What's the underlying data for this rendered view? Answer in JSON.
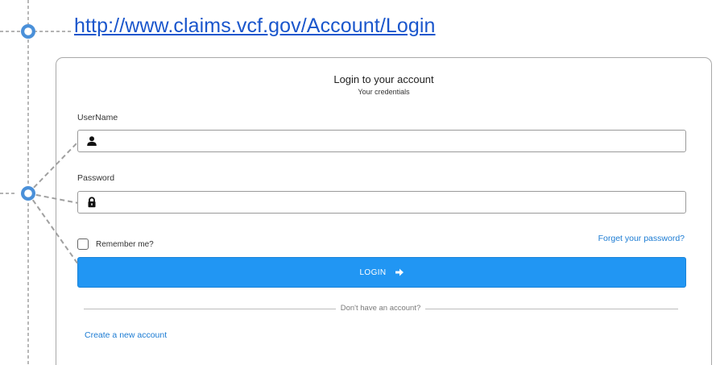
{
  "url": "http://www.claims.vcf.gov/Account/Login",
  "login": {
    "title": "Login to your account",
    "subtitle": "Your credentials",
    "username_label": "UserName",
    "username_value": "",
    "password_label": "Password",
    "password_value": "",
    "remember_label": "Remember me?",
    "remember_checked": false,
    "forgot_label": "Forget your password?",
    "login_button_label": "LOGIN",
    "divider_text": "Don't have an account?",
    "create_account_label": "Create a new account"
  },
  "icons": {
    "username": "user-icon",
    "password": "lock-icon",
    "login": "arrow-right-icon"
  },
  "colors": {
    "primary_button": "#2196f3",
    "link": "#1b7bd3",
    "url_link": "#1a56cc",
    "annotation": "#4a90d9"
  }
}
